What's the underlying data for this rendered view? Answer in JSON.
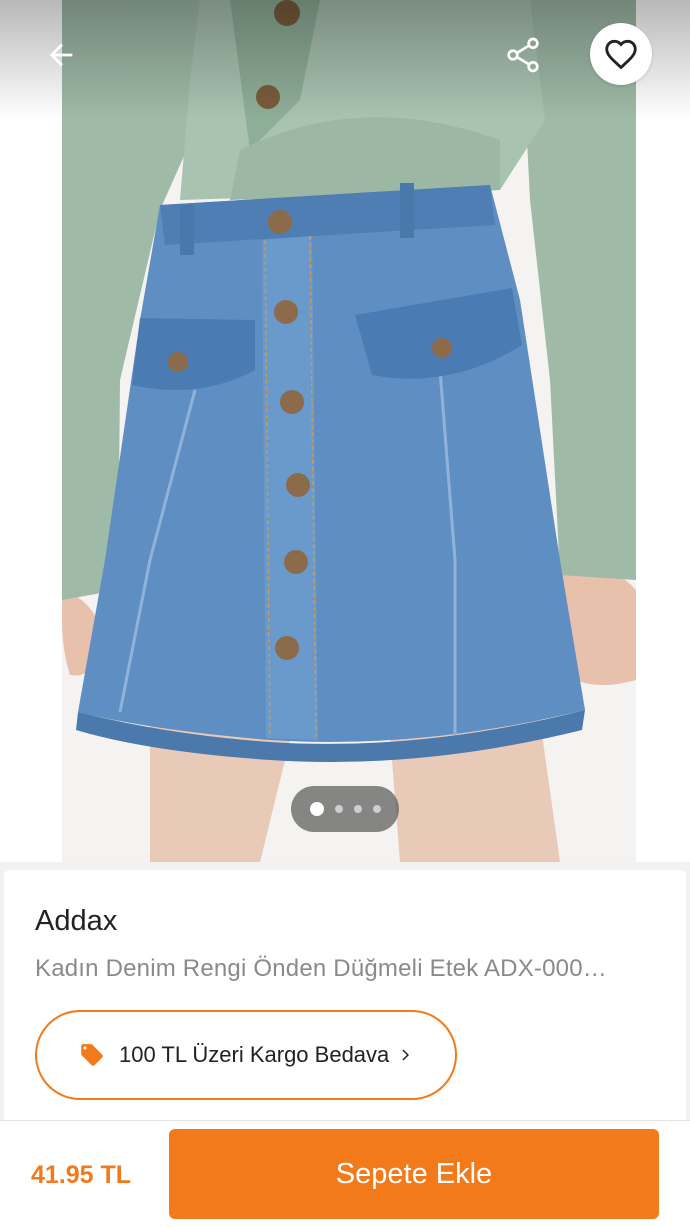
{
  "gallery": {
    "image_subject": "denim button-front skirt with sage green shirt",
    "page_count": 4,
    "active_page": 1
  },
  "icons": {
    "back": "arrow-left-icon",
    "share": "share-icon",
    "favorite": "heart-outline-icon",
    "promo": "price-tag-icon",
    "promo_arrow": "chevron-right-icon"
  },
  "product": {
    "brand": "Addax",
    "title": "Kadın Denim Rengi Önden Düğmeli Etek ADX-000…"
  },
  "promo": {
    "label": "100 TL Üzeri Kargo Bedava"
  },
  "footer": {
    "price": "41.95 TL",
    "add_to_cart_label": "Sepete Ekle"
  },
  "colors": {
    "accent": "#f27a1a",
    "text": "#222222",
    "muted": "#8a8a8a"
  }
}
